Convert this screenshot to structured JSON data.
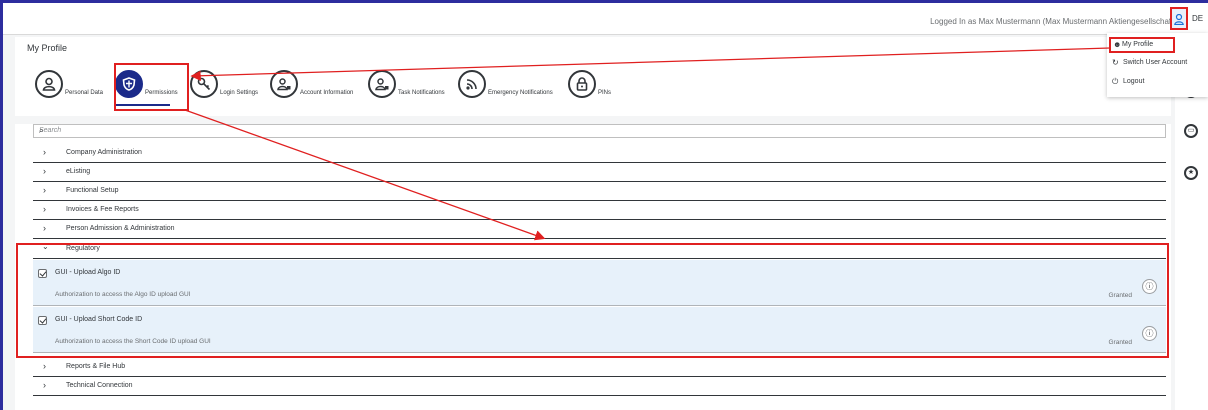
{
  "topbar": {
    "logged_in_text": "Logged In as Max Mustermann (Max Mustermann Aktiengesellschaft)",
    "language": "DE"
  },
  "page": {
    "title": "My Profile"
  },
  "tabs": [
    {
      "label": "Personal Data",
      "icon": "person-icon"
    },
    {
      "label": "Permissions",
      "icon": "shield-icon",
      "selected": true
    },
    {
      "label": "Login Settings",
      "icon": "key-icon"
    },
    {
      "label": "Account Information",
      "icon": "account-card-icon"
    },
    {
      "label": "Task Notifications",
      "icon": "task-person-icon"
    },
    {
      "label": "Emergency Notifications",
      "icon": "signal-icon"
    },
    {
      "label": "PINs",
      "icon": "lock-icon"
    }
  ],
  "search": {
    "placeholder": "Search"
  },
  "groups": [
    {
      "label": "Company Administration",
      "expanded": false
    },
    {
      "label": "eListing",
      "expanded": false
    },
    {
      "label": "Functional Setup",
      "expanded": false
    },
    {
      "label": "Invoices & Fee Reports",
      "expanded": false
    },
    {
      "label": "Person Admission & Administration",
      "expanded": false
    },
    {
      "label": "Regulatory",
      "expanded": true
    },
    {
      "label": "Reports & File Hub",
      "expanded": false
    },
    {
      "label": "Technical Connection",
      "expanded": false
    }
  ],
  "permissions": [
    {
      "name": "GUI - Upload Algo ID",
      "description": "Authorization to access the Algo ID upload GUI",
      "status": "Granted",
      "checked": true
    },
    {
      "name": "GUI - Upload Short Code ID",
      "description": "Authorization to access the Short Code ID upload GUI",
      "status": "Granted",
      "checked": true
    }
  ],
  "user_menu": [
    {
      "label": "My Profile",
      "icon": "person-icon"
    },
    {
      "label": "Switch User Account",
      "icon": "switch-icon"
    },
    {
      "label": "Logout",
      "icon": "power-icon"
    }
  ],
  "colors": {
    "accent": "#1b2a8a",
    "annotation": "#e02020",
    "selected_row": "#e7f1fa"
  }
}
